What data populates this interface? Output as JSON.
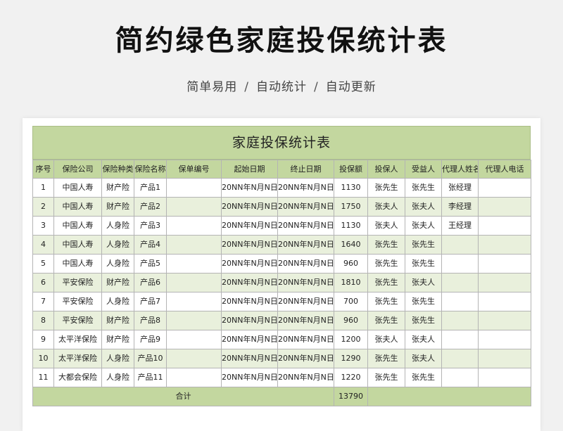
{
  "title": "简约绿色家庭投保统计表",
  "subtitle": {
    "parts": [
      "简单易用",
      "自动统计",
      "自动更新"
    ],
    "separator": "/"
  },
  "sheet": {
    "title": "家庭投保统计表",
    "columns": [
      "序号",
      "保险公司",
      "保险种类",
      "保险名称",
      "保单编号",
      "起始日期",
      "终止日期",
      "投保额",
      "投保人",
      "受益人",
      "代理人姓名",
      "代理人电话"
    ],
    "rows": [
      [
        "1",
        "中国人寿",
        "财产险",
        "产品1",
        "",
        "20NN年N月N日",
        "20NN年N月N日",
        "1130",
        "张先生",
        "张先生",
        "张经理",
        ""
      ],
      [
        "2",
        "中国人寿",
        "财产险",
        "产品2",
        "",
        "20NN年N月N日",
        "20NN年N月N日",
        "1750",
        "张夫人",
        "张夫人",
        "李经理",
        ""
      ],
      [
        "3",
        "中国人寿",
        "人身险",
        "产品3",
        "",
        "20NN年N月N日",
        "20NN年N月N日",
        "1130",
        "张夫人",
        "张夫人",
        "王经理",
        ""
      ],
      [
        "4",
        "中国人寿",
        "人身险",
        "产品4",
        "",
        "20NN年N月N日",
        "20NN年N月N日",
        "1640",
        "张先生",
        "张先生",
        "",
        ""
      ],
      [
        "5",
        "中国人寿",
        "人身险",
        "产品5",
        "",
        "20NN年N月N日",
        "20NN年N月N日",
        "960",
        "张先生",
        "张先生",
        "",
        ""
      ],
      [
        "6",
        "平安保险",
        "财产险",
        "产品6",
        "",
        "20NN年N月N日",
        "20NN年N月N日",
        "1810",
        "张先生",
        "张夫人",
        "",
        ""
      ],
      [
        "7",
        "平安保险",
        "人身险",
        "产品7",
        "",
        "20NN年N月N日",
        "20NN年N月N日",
        "700",
        "张先生",
        "张先生",
        "",
        ""
      ],
      [
        "8",
        "平安保险",
        "财产险",
        "产品8",
        "",
        "20NN年N月N日",
        "20NN年N月N日",
        "960",
        "张先生",
        "张先生",
        "",
        ""
      ],
      [
        "9",
        "太平洋保险",
        "财产险",
        "产品9",
        "",
        "20NN年N月N日",
        "20NN年N月N日",
        "1200",
        "张夫人",
        "张夫人",
        "",
        ""
      ],
      [
        "10",
        "太平洋保险",
        "人身险",
        "产品10",
        "",
        "20NN年N月N日",
        "20NN年N月N日",
        "1290",
        "张先生",
        "张夫人",
        "",
        ""
      ],
      [
        "11",
        "大都会保险",
        "人身险",
        "产品11",
        "",
        "20NN年N月N日",
        "20NN年N月N日",
        "1220",
        "张先生",
        "张先生",
        "",
        ""
      ]
    ],
    "total": {
      "label": "合计",
      "amount": "13790"
    }
  },
  "colors": {
    "header_green": "#c3d79f",
    "stripe_green": "#e9f0dc",
    "background": "#f1f1f1"
  }
}
